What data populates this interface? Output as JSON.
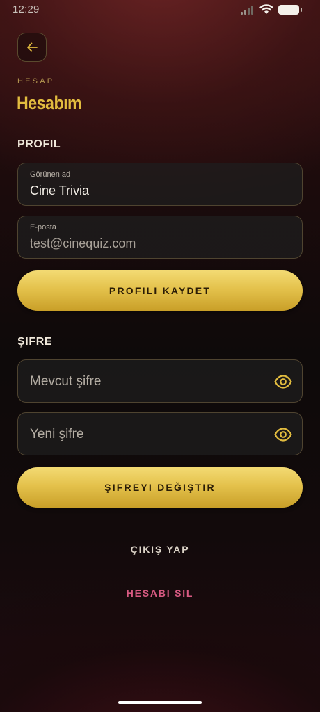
{
  "status_bar": {
    "time": "12:29"
  },
  "header": {
    "kicker": "HESAP",
    "title": "Hesabım"
  },
  "profile": {
    "heading": "PROFIL",
    "display_name": {
      "label": "Görünen ad",
      "value": "Cine Trivia"
    },
    "email": {
      "label": "E-posta",
      "value": "test@cinequiz.com"
    },
    "save_label": "PROFILI KAYDET"
  },
  "password": {
    "heading": "ŞIFRE",
    "current_placeholder": "Mevcut şifre",
    "new_placeholder": "Yeni şifre",
    "change_label": "ŞIFREYI DEĞIŞTIR"
  },
  "actions": {
    "logout_label": "ÇIKIŞ YAP",
    "delete_label": "HESABI SIL"
  },
  "colors": {
    "accent_gold": "#e2bc3f",
    "danger_pink": "#d85a82"
  }
}
